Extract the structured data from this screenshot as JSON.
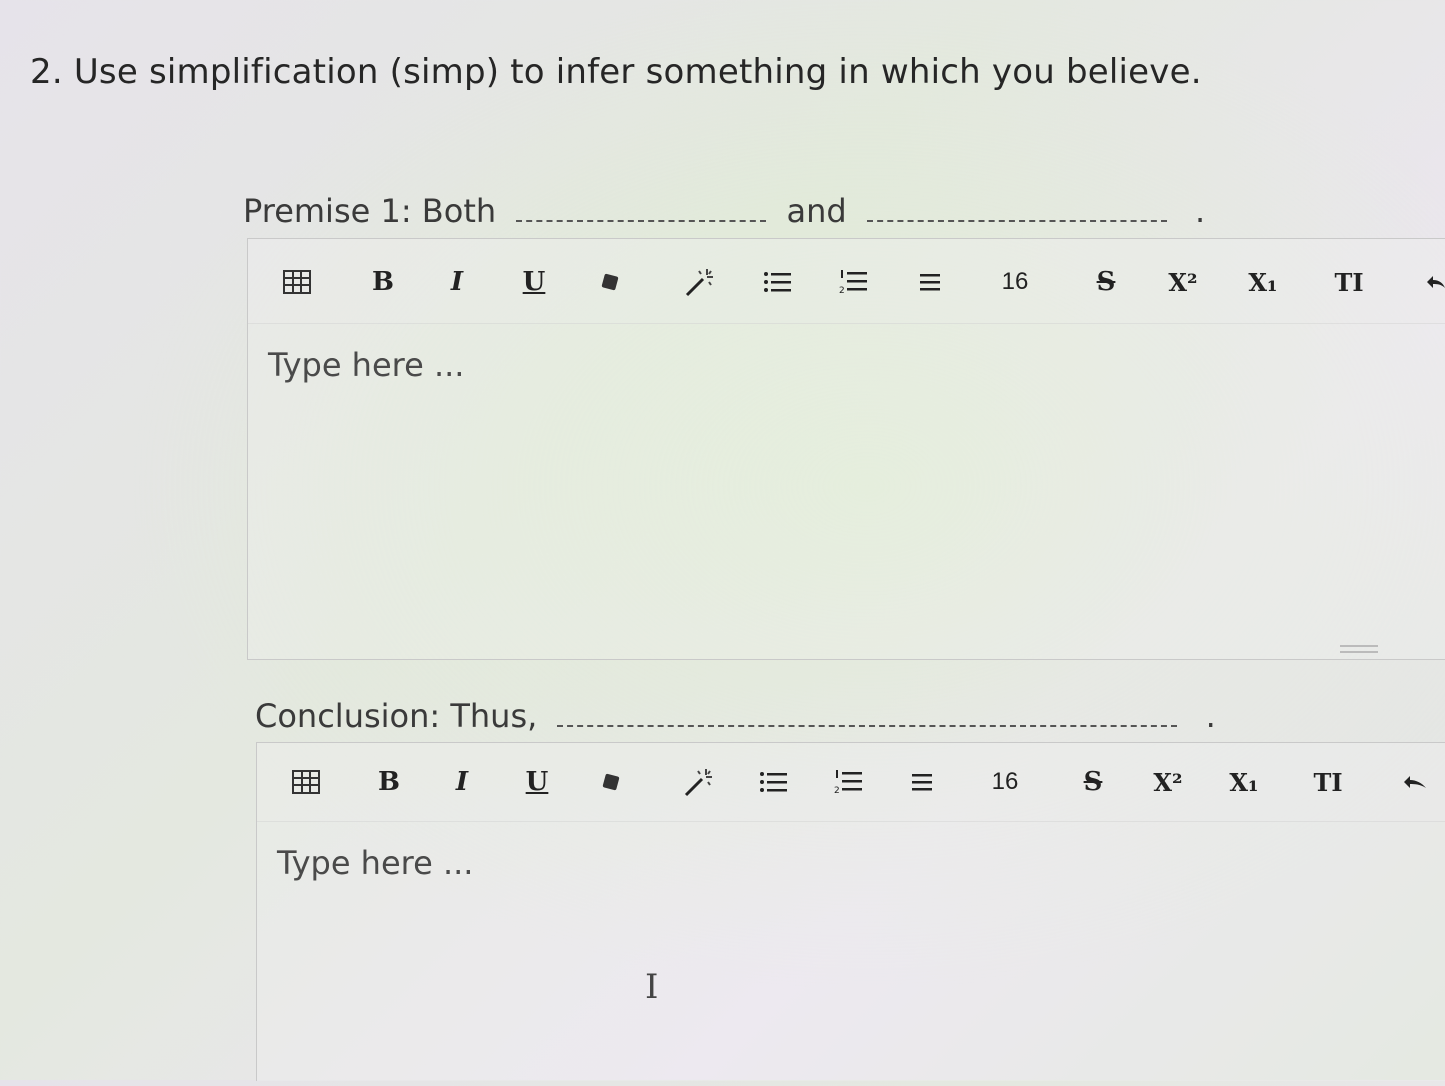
{
  "question": {
    "text": "2. Use simplification (simp) to infer something in which you believe."
  },
  "premise": {
    "prefix": "Premise 1: Both",
    "middle": "and",
    "suffix": "."
  },
  "conclusion": {
    "prefix": "Conclusion: Thus,",
    "suffix": "."
  },
  "toolbar": {
    "bold": "B",
    "italic": "I",
    "underline": "U",
    "font_size": "16",
    "strike": "S",
    "superscript": "X²",
    "subscript": "X₁",
    "clear_format": "TI"
  },
  "editors": [
    {
      "placeholder": "Type here ..."
    },
    {
      "placeholder": "Type here ..."
    }
  ]
}
